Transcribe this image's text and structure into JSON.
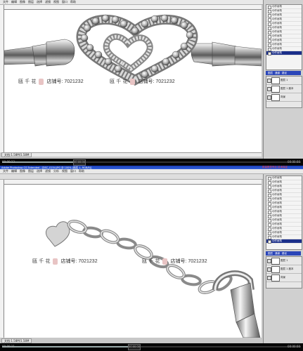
{
  "top_player": {
    "time_left": "00:00:13",
    "time_right": "00:00:00",
    "middle_label": "00:00:00"
  },
  "app1": {
    "menu": [
      "文件",
      "编辑",
      "图像",
      "图层",
      "选择",
      "滤镜",
      "视图",
      "窗口",
      "帮助"
    ],
    "doc_info": "文档:1.58M/1.58M",
    "history_items": [
      "动作画笔",
      "动作画笔",
      "动作画笔",
      "动作画笔",
      "动作画笔",
      "动作画笔",
      "动作画笔",
      "动作画笔",
      "动作画笔",
      "动作画笔",
      "动作画笔",
      "动作画笔"
    ],
    "layer_tabs": [
      "图层",
      "通道",
      "路径"
    ],
    "layers": [
      "图层 1",
      "图层 1 副本",
      "背景"
    ]
  },
  "app2": {
    "title": "Adobe Photoshop CS Extended - [DSC_0154.JPG @ 100% (图层 1, RGB/8)]",
    "promo": "质量是您专业 技术保证",
    "menu": [
      "文件",
      "编辑",
      "图像",
      "图层",
      "选择",
      "滤镜",
      "分析",
      "视图",
      "窗口",
      "帮助"
    ],
    "doc_info": "文档:1.58M/1.58M",
    "history_items": [
      "动作画笔",
      "动作画笔",
      "动作画笔",
      "动作画笔",
      "动作画笔",
      "动作画笔",
      "动作画笔",
      "动作画笔",
      "动作画笔",
      "动作画笔",
      "动作画笔",
      "动作画笔",
      "动作画笔",
      "动作画笔",
      "动作画笔",
      "动作画笔"
    ],
    "layer_tabs": [
      "图层",
      "通道",
      "路径"
    ],
    "layers": [
      "图层 1",
      "图层 1 副本",
      "背景"
    ]
  },
  "watermark": {
    "brand": "瓯 千 花",
    "shop": "店铺号: 7021232"
  },
  "bottom_player": {
    "time_left": "00:00:11",
    "time_right": "00:00:00",
    "middle_label": "00:00:00"
  },
  "colors": {
    "canvas": "#ffffff",
    "ui_gray": "#c8c8c8",
    "selection_blue": "#1b2f8a",
    "title_blue": "#2a52c9",
    "player_black": "#050505"
  }
}
